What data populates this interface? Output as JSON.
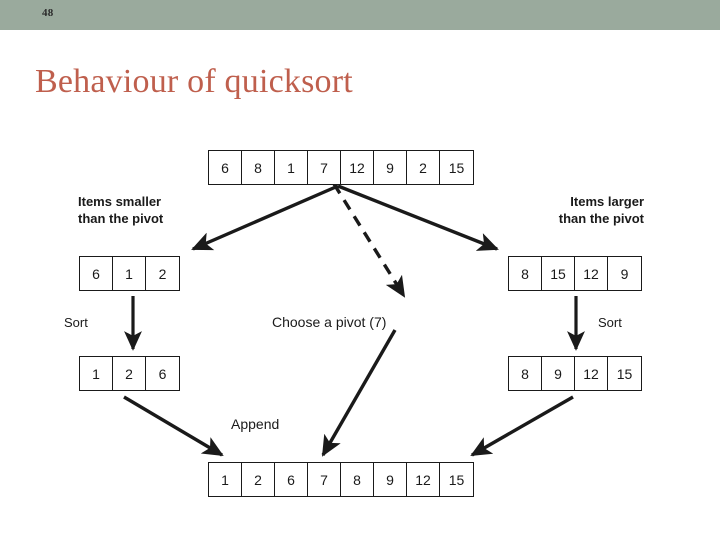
{
  "header": {
    "slide_number": "48",
    "band_color": "#9aaa9d"
  },
  "title": {
    "text": "Behaviour of quicksort",
    "color": "#bf5f4d"
  },
  "arrays": {
    "input": {
      "name": "input-array",
      "values": [
        "6",
        "8",
        "1",
        "7",
        "12",
        "9",
        "2",
        "15"
      ]
    },
    "left": {
      "name": "smaller-partition",
      "values": [
        "6",
        "1",
        "2"
      ]
    },
    "right": {
      "name": "larger-partition",
      "values": [
        "8",
        "15",
        "12",
        "9"
      ]
    },
    "left_sorted": {
      "name": "smaller-sorted",
      "values": [
        "1",
        "2",
        "6"
      ]
    },
    "right_sorted": {
      "name": "larger-sorted",
      "values": [
        "8",
        "9",
        "12",
        "15"
      ]
    },
    "output": {
      "name": "output-array",
      "values": [
        "1",
        "2",
        "6",
        "7",
        "8",
        "9",
        "12",
        "15"
      ]
    }
  },
  "captions": {
    "smaller": "Items smaller\nthan the pivot",
    "larger": "Items larger\nthan the pivot"
  },
  "labels": {
    "sort_left": "Sort",
    "sort_right": "Sort",
    "choose_pivot": "Choose a pivot (7)",
    "append": "Append"
  },
  "colors": {
    "ink": "#1a1a1a",
    "paper": "#ffffff"
  }
}
